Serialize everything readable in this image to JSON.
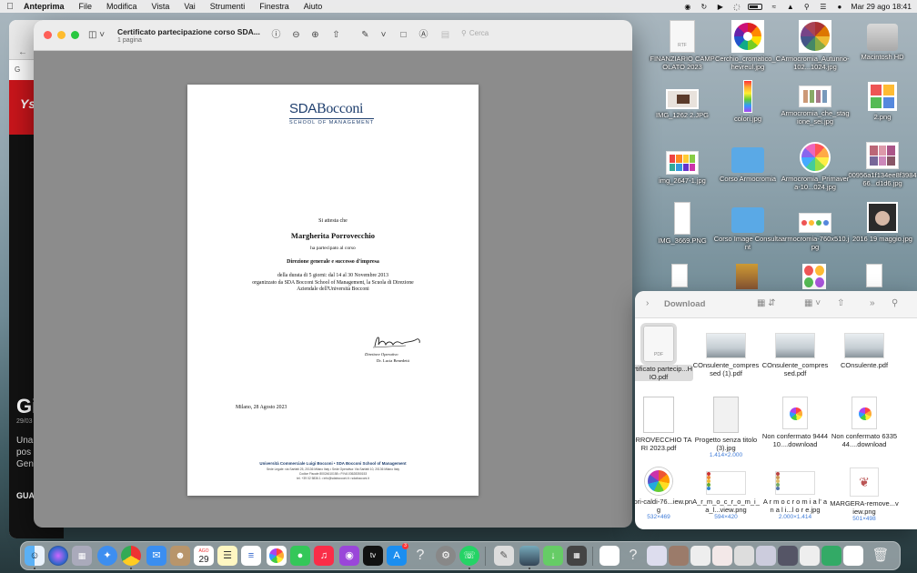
{
  "menubar": {
    "app": "Anteprima",
    "items": [
      "File",
      "Modifica",
      "Vista",
      "Vai",
      "Strumenti",
      "Finestra",
      "Aiuto"
    ],
    "clock": "Mar 29 ago  18:41"
  },
  "browser_bg": {
    "tab_letter": "G",
    "headline": "Gi",
    "date": "29/03",
    "snippet": [
      "Una",
      "pos",
      "Gen"
    ],
    "section": "GUA"
  },
  "preview": {
    "title": "Certificato partecipazione corso SDA...",
    "subtitle": "1 pagina",
    "search_placeholder": "Cerca",
    "doc": {
      "logo_main": "SDA",
      "logo_bold": "Bocconi",
      "logo_sub": "SCHOOL OF MANAGEMENT",
      "attesta": "Si attesta che",
      "name": "Margherita Porrovecchio",
      "partecipato": "ha partecipato al corso",
      "course": "Direzione generale e successo d'impresa",
      "durata_1": "della durata di 5 giorni: dal 14 al 30 Novembre 2013",
      "durata_2": "organizzato da SDA Bocconi School of Management, la Scuola di Direzione",
      "durata_3": "Aziendale dell'Università Bocconi",
      "role": "Direttore Operativo",
      "signer": "Dr. Lucia Benedetti",
      "date": "Milano, 28 Agosto 2023",
      "footer_1": "Università Commerciale Luigi Bocconi • SDA Bocconi School of Management",
      "footer_2": "Sede Legale: via Sarfatti 25, 20136 Milano Italy • Sede Operativa: Via Sarfatti 10, 20136 Milano Italy",
      "footer_3": "Codice Fiscale 80024610158 • P.IVA 03628350153",
      "footer_4": "tel. +39 02 5836.1 • info@sdabocconi.it • sdabocconi.it"
    }
  },
  "desktop": {
    "icons": [
      {
        "label": "FINANZIARIO CAMPOLATO 2023",
        "icon": "document-icon"
      },
      {
        "label": "Cerchio_cromatico_Chevreul.jpg",
        "icon": "image-icon"
      },
      {
        "label": "Armocromia_Autunno-102...1024.jpg",
        "icon": "image-icon"
      },
      {
        "label": "Macintosh HD",
        "icon": "drive-icon"
      },
      {
        "label": "IMG_1262 2.JPG",
        "icon": "image-icon"
      },
      {
        "label": "colori.jpg",
        "icon": "image-icon"
      },
      {
        "label": "Armocromia_che_stagione_sei.jpg",
        "icon": "image-icon"
      },
      {
        "label": "2.png",
        "icon": "image-icon"
      },
      {
        "label": "img_2647-1.jpg",
        "icon": "image-icon"
      },
      {
        "label": "Corso Armocromia",
        "icon": "folder-icon"
      },
      {
        "label": "Armocromia_Primavera-10...024.jpg",
        "icon": "image-icon"
      },
      {
        "label": "00956a1f134ee8f398466...d1d6.jpg",
        "icon": "image-icon"
      },
      {
        "label": "IMG_3669.PNG",
        "icon": "image-icon"
      },
      {
        "label": "Corso Image Consultant",
        "icon": "folder-icon"
      },
      {
        "label": "armocromia-760x510.jpg",
        "icon": "image-icon"
      },
      {
        "label": "2016 19 maggio.jpg",
        "icon": "image-icon"
      }
    ],
    "edge_labels": {
      "ato": "ATO",
      "year": "023"
    }
  },
  "finder": {
    "title": "Download",
    "items": [
      {
        "name": "Certificato partecip...HIO.pdf",
        "dims": "",
        "selected": true
      },
      {
        "name": "COnsulente_compressed (1).pdf",
        "dims": ""
      },
      {
        "name": "COnsulente_compressed.pdf",
        "dims": ""
      },
      {
        "name": "COnsulente.pdf",
        "dims": ""
      },
      {
        "name": "PORROVECCHIO TARI 2023.pdf",
        "dims": ""
      },
      {
        "name": "Progetto senza titolo (3).jpg",
        "dims": "1.414×2.000"
      },
      {
        "name": "Non confermato 944410....download",
        "dims": ""
      },
      {
        "name": "Non confermato 633544....download",
        "dims": ""
      },
      {
        "name": "colori-caldi-76...iew.png",
        "dims": "532×469"
      },
      {
        "name": "A_r_m_o_c_r_o_m_i_a_l...view.png",
        "dims": "594×420"
      },
      {
        "name": "A r m o c r o m i a l' a n a l i...l o r e.jpg",
        "dims": "2.000×1.414"
      },
      {
        "name": "MARGERA-remove...view.png",
        "dims": "501×498"
      }
    ]
  },
  "dock": {
    "calendar_month": "AGO",
    "calendar_day": "29",
    "appstore_badge": "3",
    "apps": [
      "Finder",
      "Siri",
      "Launchpad",
      "Safari",
      "Chrome",
      "Mail",
      "Contatti",
      "Calendario",
      "Note",
      "Promemoria",
      "Foto",
      "Messaggi",
      "Musica",
      "Podcast",
      "TV",
      "App Store",
      "Aiuto",
      "Impostazioni",
      "WhatsApp",
      "Anteprima",
      "Calcolatrice",
      "Cestino"
    ]
  }
}
